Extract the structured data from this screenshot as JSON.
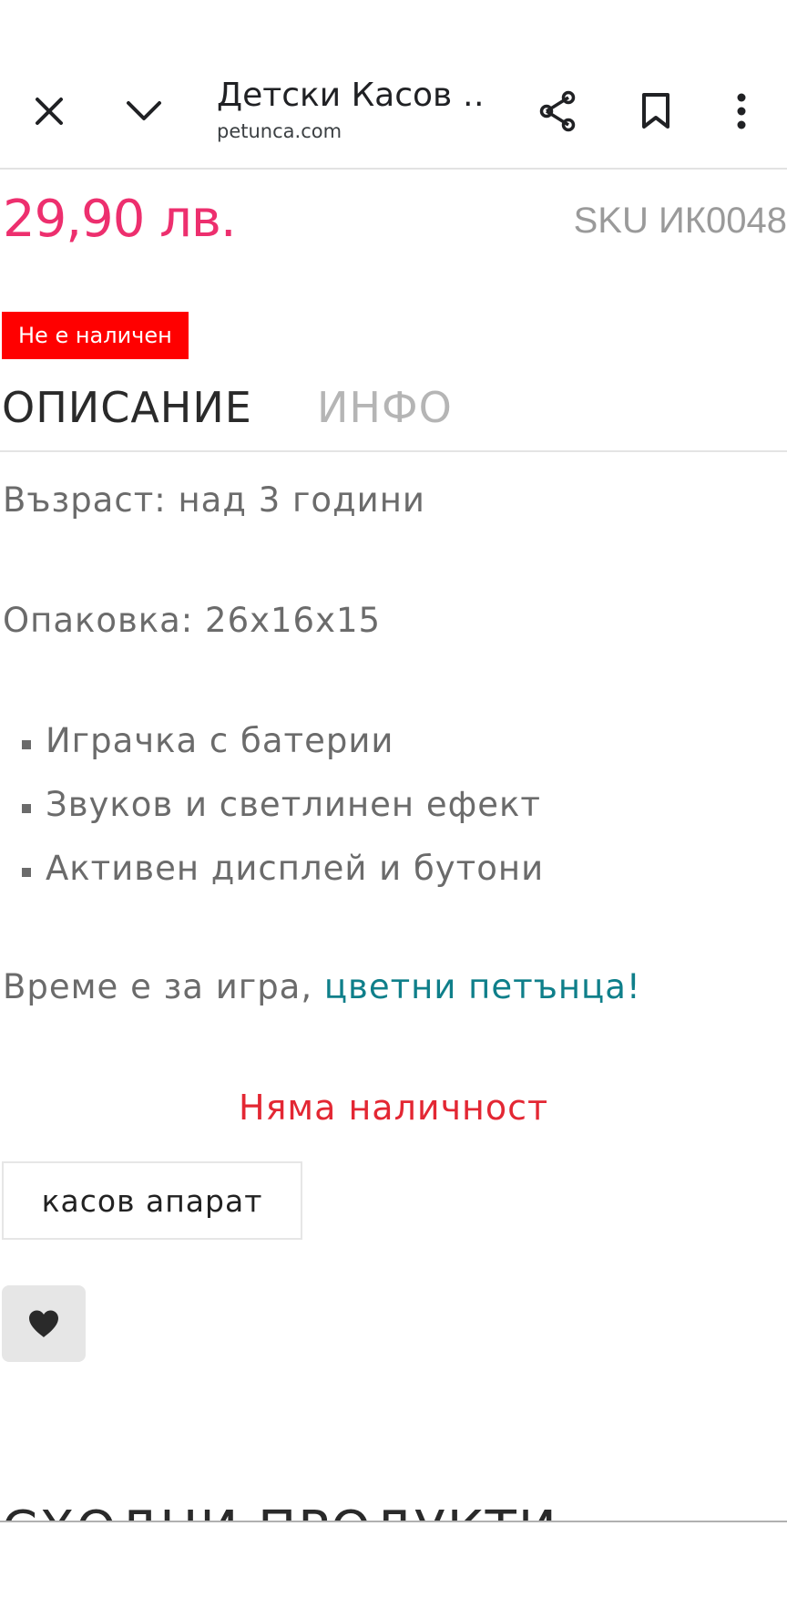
{
  "toolbar": {
    "title": "Детски Касов …",
    "domain": "petunca.com",
    "icons": [
      "close-icon",
      "chevron-down-icon",
      "share-icon",
      "bookmark-icon",
      "more-vert-icon"
    ]
  },
  "product": {
    "price": "29,90 лв.",
    "sku": "SKU ИК0048",
    "stock_badge": "Не е наличен"
  },
  "tabs": [
    {
      "label": "ОПИСАНИЕ",
      "active": true
    },
    {
      "label": "ИНФО",
      "active": false
    }
  ],
  "description": {
    "age": "Възраст: над 3 години",
    "package": "Опаковка: 26x16x15",
    "features": [
      "Играчка с батерии",
      "Звуков и светлинен ефект",
      "Активен дисплей и бутони"
    ],
    "closing_text": "Време е за игра, ",
    "closing_link": "цветни петънца!"
  },
  "availability": "Няма наличност",
  "tag": "касов апарат",
  "related_title": "СХОДНИ ПРОДУКТИ",
  "colors": {
    "price": "#ed2f6e",
    "badge": "#ff0000",
    "link": "#0f7f8a",
    "out_of_stock": "#e32733"
  }
}
